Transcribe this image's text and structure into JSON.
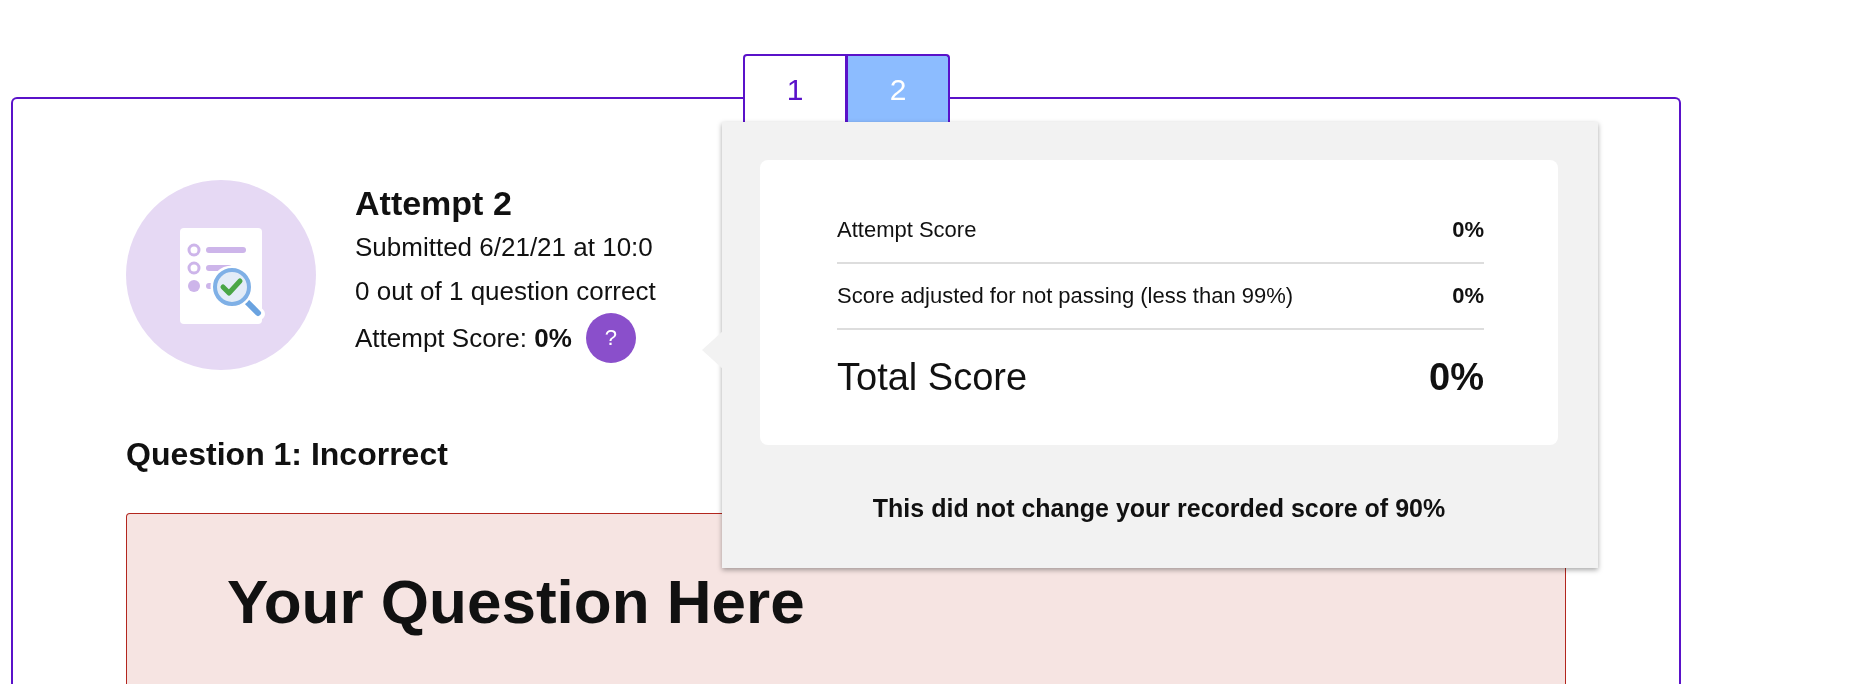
{
  "tabs": [
    {
      "label": "1",
      "selected": false
    },
    {
      "label": "2",
      "selected": true
    }
  ],
  "attempt": {
    "title": "Attempt 2",
    "submitted": "Submitted 6/21/21 at 10:0",
    "questions_correct": "0 out of 1 question correct",
    "score": "Attempt Score: **0%**",
    "help_button": "?"
  },
  "score_popover": {
    "rows": [
      {
        "kind": "line",
        "label": "Attempt Score",
        "value": "0%"
      },
      {
        "kind": "line",
        "label": "Score adjusted for not passing (less than 99%)",
        "value": "0%"
      },
      {
        "kind": "total",
        "label": "Total Score",
        "value": "0%"
      }
    ],
    "note": "This did not change your recorded score of 90%"
  },
  "question": {
    "heading": "Question 1: Incorrect",
    "title": "Your Question Here"
  }
}
